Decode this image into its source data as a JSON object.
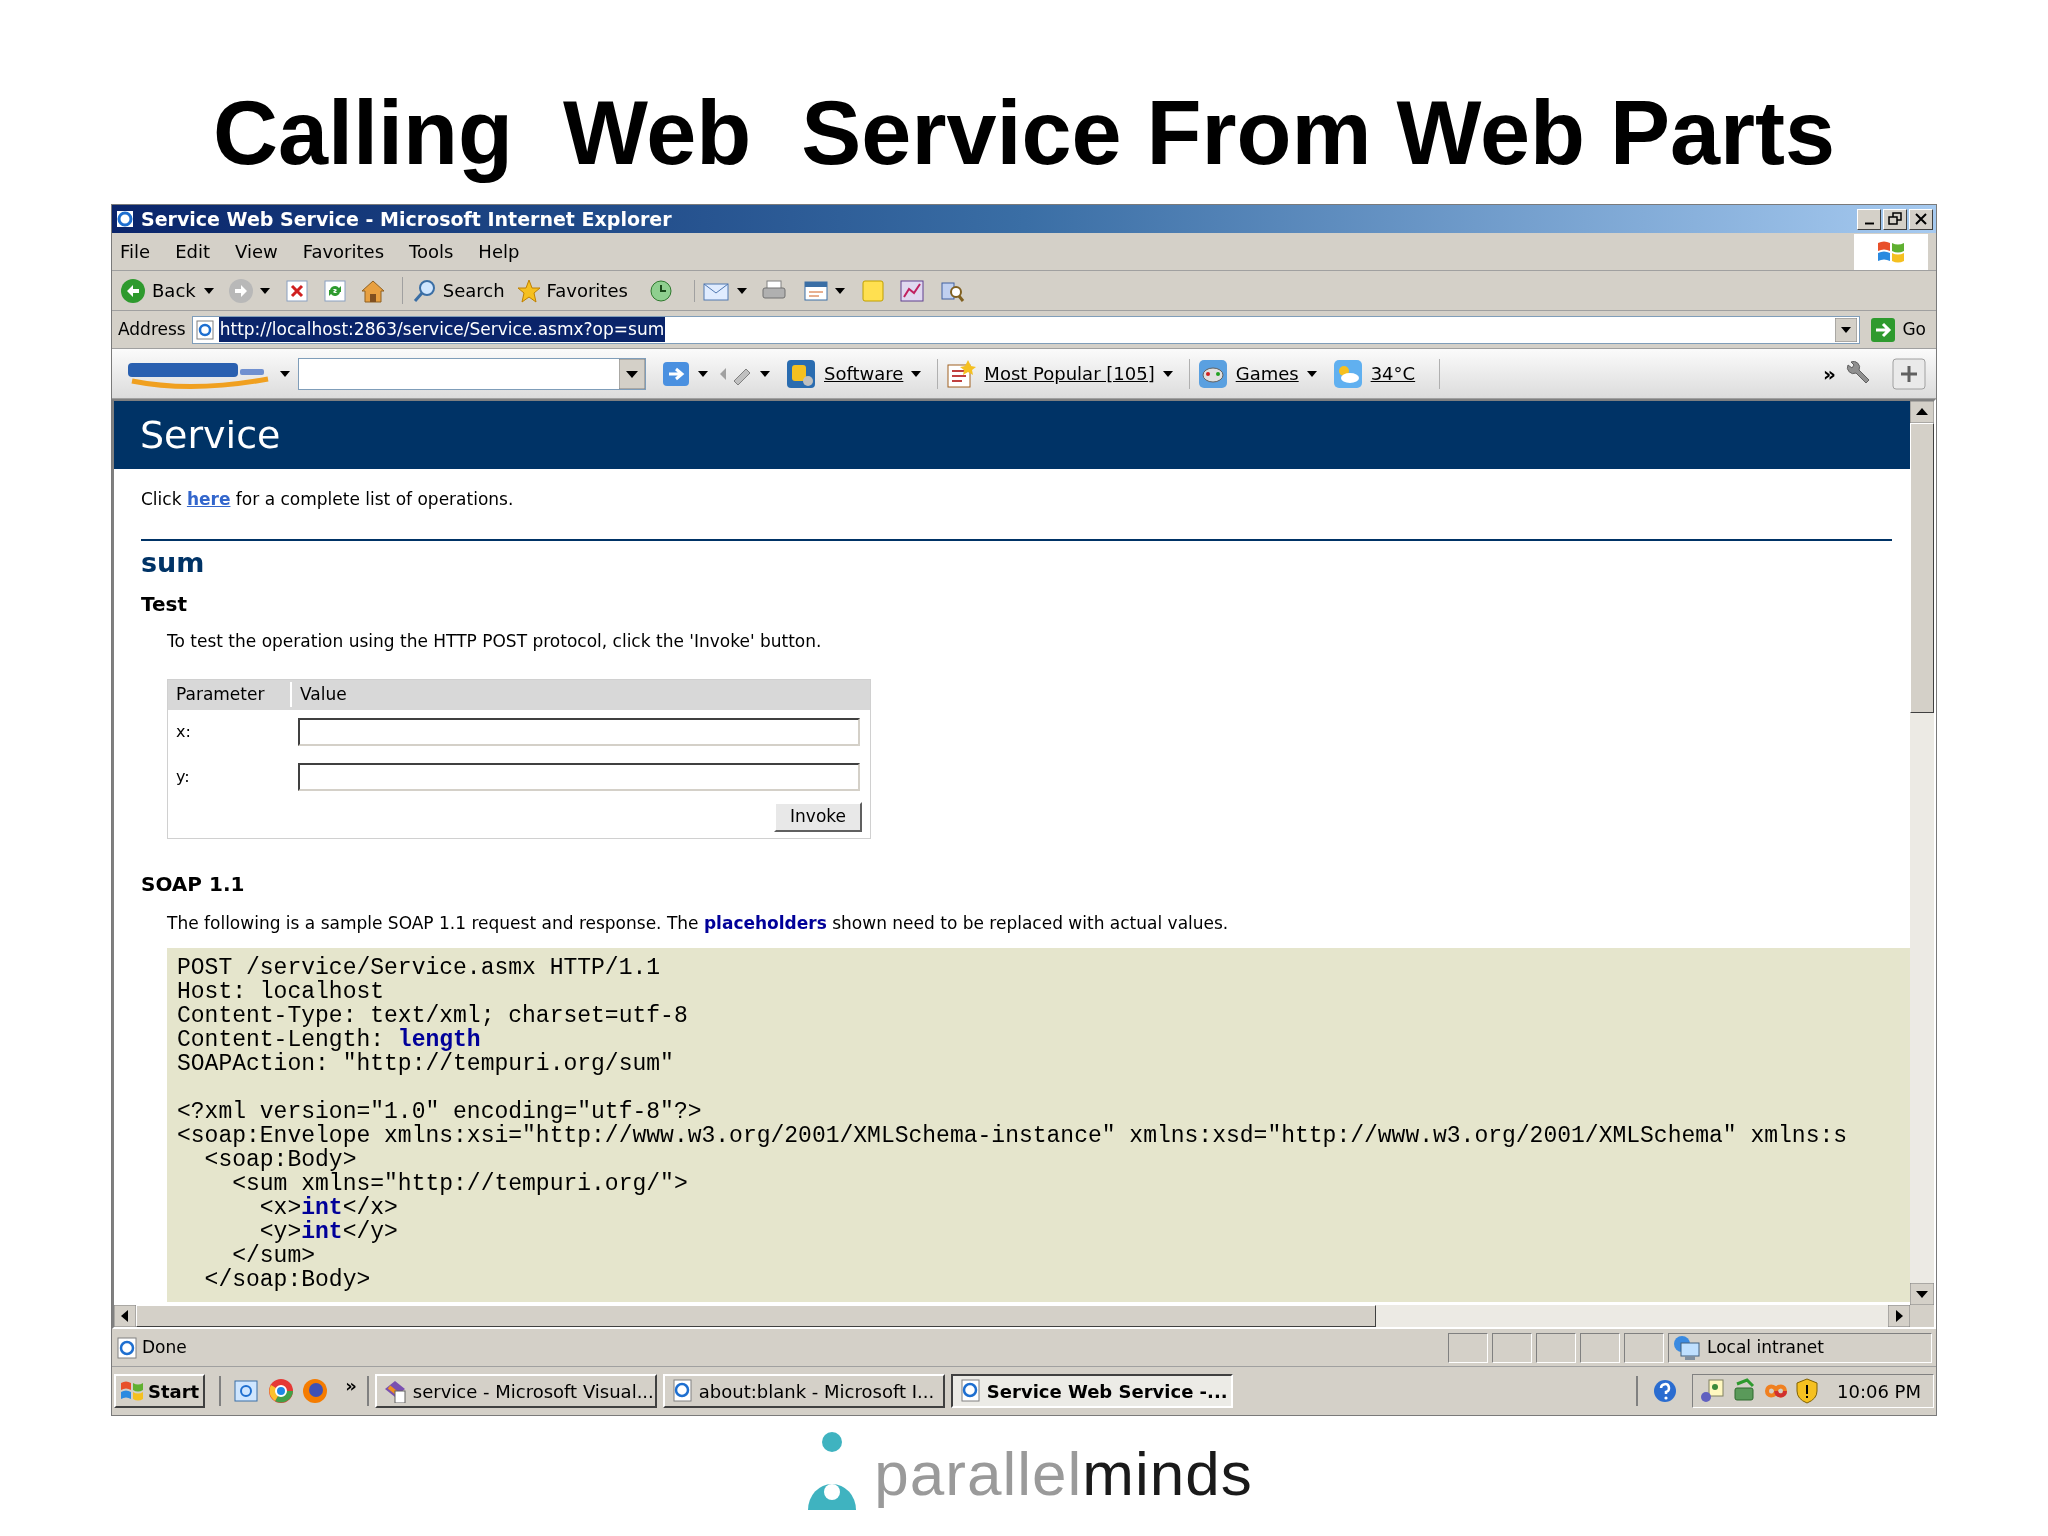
{
  "slide_title": "Calling  Web  Service From Web Parts",
  "window": {
    "title": "Service Web Service - Microsoft Internet Explorer"
  },
  "menu": [
    {
      "label": "File"
    },
    {
      "label": "Edit"
    },
    {
      "label": "View"
    },
    {
      "label": "Favorites"
    },
    {
      "label": "Tools"
    },
    {
      "label": "Help"
    }
  ],
  "toolbar": {
    "back": "Back",
    "search": "Search",
    "favorites": "Favorites"
  },
  "address": {
    "label": "Address",
    "url": "http://localhost:2863/service/Service.asmx?op=sum",
    "go": "Go"
  },
  "links_bar": {
    "items": [
      {
        "label": "Software"
      },
      {
        "label": "Most Popular [105]"
      },
      {
        "label": "Games"
      },
      {
        "label": "34°C"
      }
    ],
    "more": "»"
  },
  "page": {
    "heading": "Service",
    "intro_before": "Click ",
    "intro_link": "here",
    "intro_after": " for a complete list of operations.",
    "operation": "sum",
    "test_heading": "Test",
    "test_text": "To test the operation using the HTTP POST protocol, click the 'Invoke' button.",
    "param_table": {
      "columns": [
        "Parameter",
        "Value"
      ],
      "rows": [
        {
          "name": "x:"
        },
        {
          "name": "y:"
        }
      ]
    },
    "invoke": "Invoke",
    "soap_heading": "SOAP 1.1",
    "soap_text": "The following is a sample SOAP 1.1 request and response. The **placeholders** shown need to be replaced with actual values.",
    "code": [
      [
        "POST /service/Service.asmx HTTP/1.1",
        "Host: localhost",
        "Content-Type: text/xml; charset=utf-8",
        "Content-Length: **length**",
        "SOAPAction: \"http://tempuri.org/sum\""
      ],
      [
        "<?xml version=\"1.0\" encoding=\"utf-8\"?>",
        "<soap:Envelope xmlns:xsi=\"http://www.w3.org/2001/XMLSchema-instance\" xmlns:xsd=\"http://www.w3.org/2001/XMLSchema\" xmlns:s",
        "  <soap:Body>",
        "    <sum xmlns=\"http://tempuri.org/\">",
        "      <x>**int**</x>",
        "      <y>**int**</y>",
        "    </sum>",
        "  </soap:Body>"
      ]
    ]
  },
  "status_bar": {
    "text": "Done",
    "zone": "Local intranet"
  },
  "taskbar": {
    "start": "Start",
    "more": "»",
    "tasks": [
      {
        "label": "service - Microsoft Visual...",
        "selected": false
      },
      {
        "label": "about:blank - Microsoft I...",
        "selected": false
      },
      {
        "label": "Service Web Service -...",
        "selected": true
      }
    ],
    "clock": "10:06 PM"
  },
  "logo": {
    "light": "parallel",
    "dark": "minds"
  }
}
